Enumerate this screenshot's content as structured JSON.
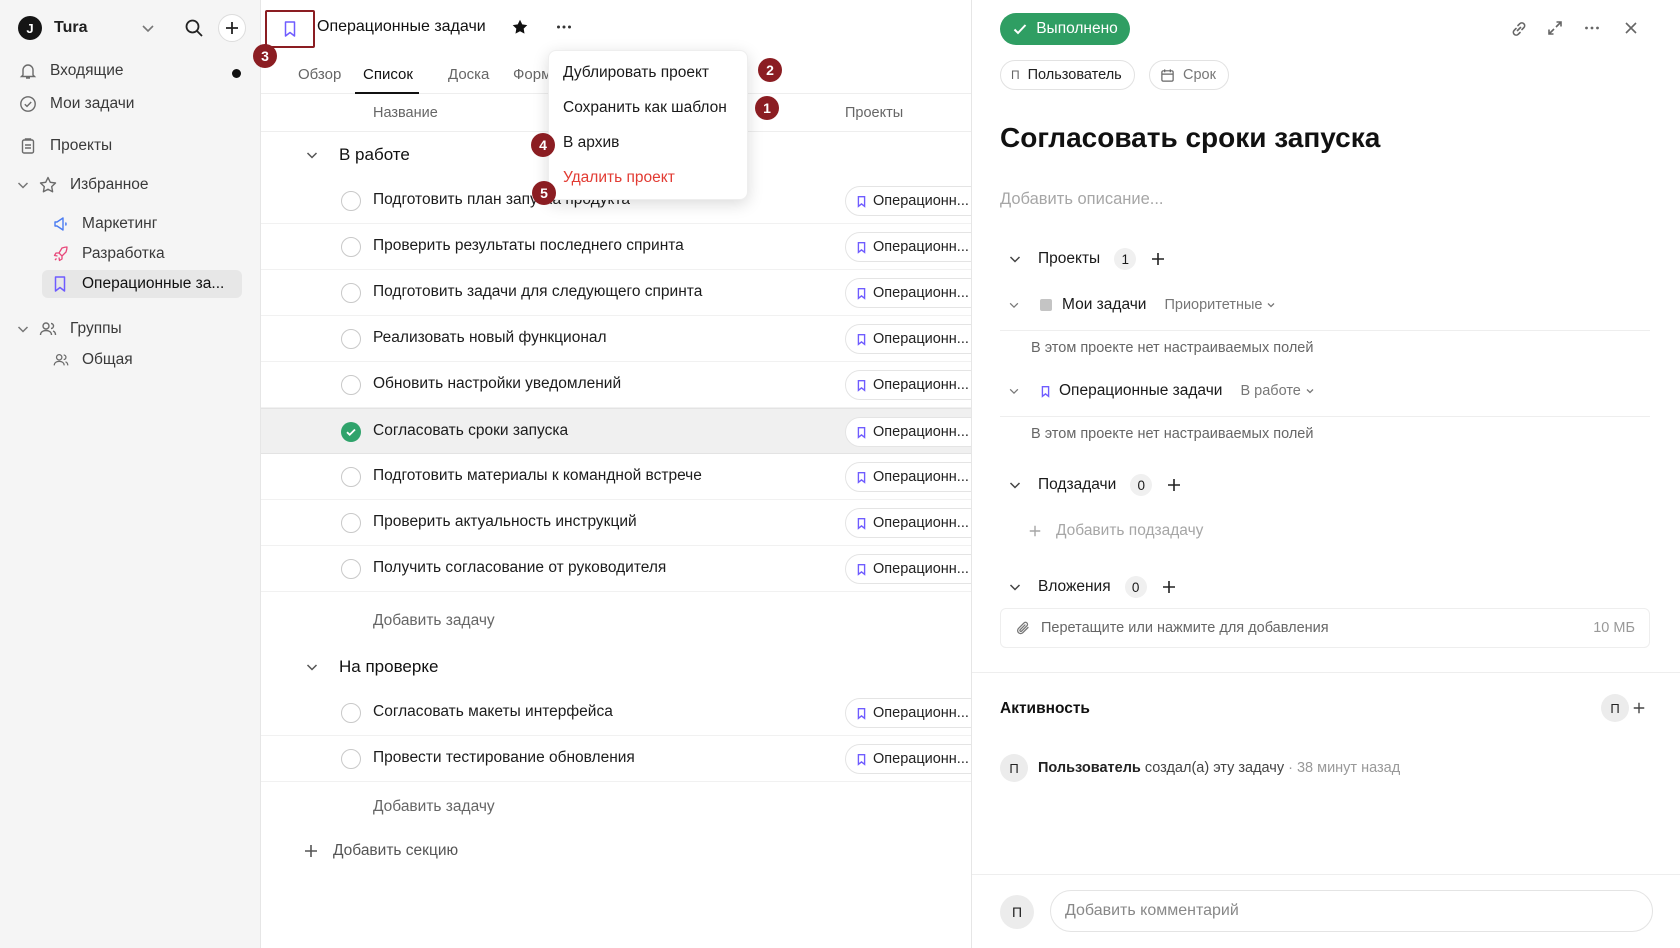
{
  "workspace": {
    "logo": "J",
    "name": "Tura"
  },
  "sidebar": {
    "inbox": "Входящие",
    "my_tasks": "Мои задачи",
    "projects": "Проекты",
    "favorites": {
      "label": "Избранное",
      "items": [
        {
          "label": "Маркетинг",
          "icon": "megaphone-icon"
        },
        {
          "label": "Разработка",
          "icon": "rocket-icon"
        },
        {
          "label": "Операционные за...",
          "icon": "bookmark-icon"
        }
      ]
    },
    "groups": {
      "label": "Группы",
      "items": [
        {
          "label": "Общая",
          "icon": "people-icon"
        }
      ]
    }
  },
  "project": {
    "title": "Операционные задачи",
    "tabs": [
      "Обзор",
      "Список",
      "Доска",
      "Форм"
    ],
    "active_tab": "Список",
    "columns": {
      "name": "Название",
      "projects": "Проекты"
    }
  },
  "menu": {
    "items": [
      "Дублировать проект",
      "Сохранить как шаблон",
      "В архив",
      "Удалить проект"
    ]
  },
  "badges": [
    "1",
    "2",
    "3",
    "4",
    "5"
  ],
  "sections": [
    {
      "title": "В работе",
      "tasks": [
        {
          "name": "Подготовить план запуска продукта",
          "project": "Операционн...",
          "done": false
        },
        {
          "name": "Проверить результаты последнего спринта",
          "project": "Операционн...",
          "done": false
        },
        {
          "name": "Подготовить задачи для следующего спринта",
          "project": "Операционн...",
          "done": false
        },
        {
          "name": "Реализовать новый функционал",
          "project": "Операционн...",
          "done": false
        },
        {
          "name": "Обновить настройки уведомлений",
          "project": "Операционн...",
          "done": false
        },
        {
          "name": "Согласовать сроки запуска",
          "project": "Операционн...",
          "done": true
        },
        {
          "name": "Подготовить материалы к командной встрече",
          "project": "Операционн...",
          "done": false
        },
        {
          "name": "Проверить актуальность инструкций",
          "project": "Операционн...",
          "done": false
        },
        {
          "name": "Получить согласование от руководителя",
          "project": "Операционн...",
          "done": false
        }
      ],
      "add_task": "Добавить задачу"
    },
    {
      "title": "На проверке",
      "tasks": [
        {
          "name": "Согласовать макеты интерфейса",
          "project": "Операционн...",
          "done": false
        },
        {
          "name": "Провести тестирование обновления",
          "project": "Операционн...",
          "done": false
        }
      ],
      "add_task": "Добавить задачу"
    }
  ],
  "add_section": "Добавить секцию",
  "detail": {
    "status_button": "Выполнено",
    "assignee_initial": "П",
    "assignee": "Пользователь",
    "due": "Срок",
    "title": "Согласовать сроки запуска",
    "description_placeholder": "Добавить описание...",
    "projects_label": "Проекты",
    "projects_count": "1",
    "project_rows": [
      {
        "name": "Мои задачи",
        "status": "Приоритетные"
      },
      {
        "name": "Операционные задачи",
        "status": "В работе"
      }
    ],
    "no_fields": "В этом проекте нет настраиваемых полей",
    "subtasks_label": "Подзадачи",
    "subtasks_count": "0",
    "add_subtask": "Добавить подзадачу",
    "attachments_label": "Вложения",
    "attachments_count": "0",
    "drop_hint": "Перетащите или нажмите для добавления",
    "size_limit": "10 МБ",
    "activity_label": "Активность",
    "activity_entry": {
      "user": "Пользователь",
      "action": "создал(а) эту задачу",
      "time": "· 38 минут назад"
    },
    "comment_placeholder": "Добавить комментарий"
  },
  "colors": {
    "accent": "#6f5cff",
    "success": "#2f9e63",
    "danger": "#e23b33",
    "badge": "#8b1d22"
  }
}
